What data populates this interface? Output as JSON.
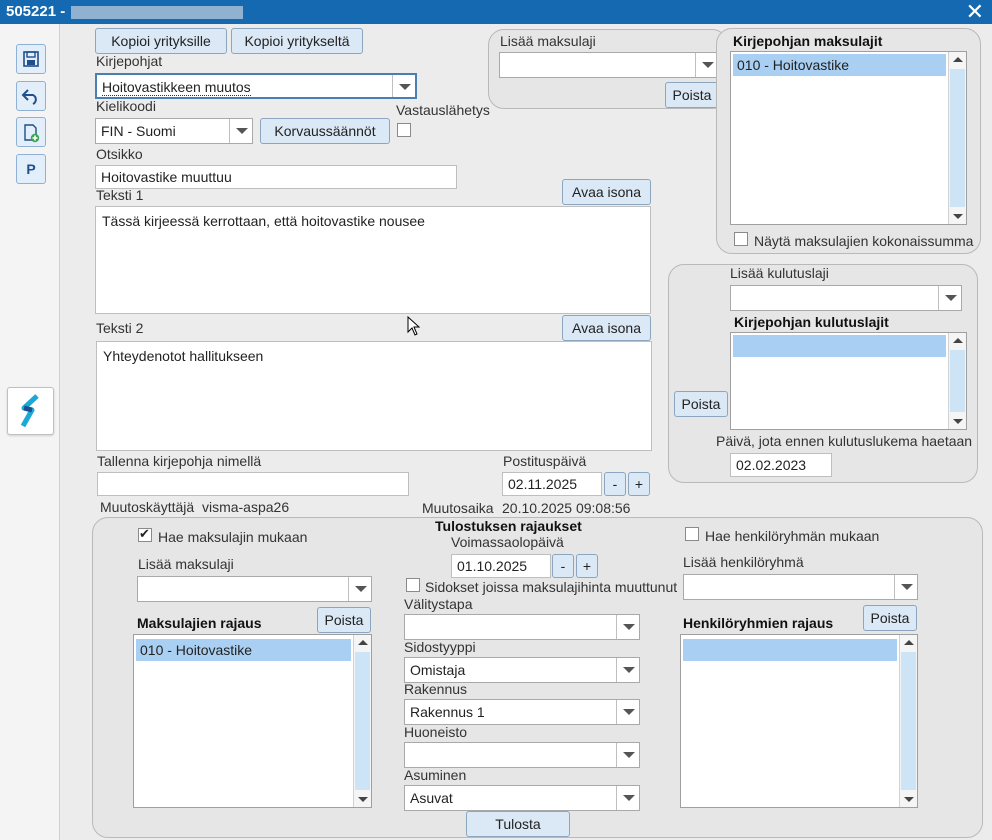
{
  "window": {
    "title": "505221 -",
    "close_label": "✕"
  },
  "toolbar": {
    "p_label": "P"
  },
  "header": {
    "copy_to_companies": "Kopioi yrityksille",
    "copy_from_company": "Kopioi yritykseltä"
  },
  "template": {
    "kirjepohjat_label": "Kirjepohjat",
    "kirjepohjat_value": "Hoitovastikkeen muutos",
    "kielikoodi_label": "Kielikoodi",
    "kielikoodi_value": "FIN - Suomi",
    "korvaussaannot": "Korvaussäännöt",
    "vastauslahetys_label": "Vastauslähetys",
    "otsikko_label": "Otsikko",
    "otsikko_value": "Hoitovastike muuttuu",
    "teksti1_label": "Teksti 1",
    "teksti1_value": "Tässä kirjeessä kerrottaan, että hoitovastike nousee",
    "teksti2_label": "Teksti 2",
    "teksti2_value": "Yhteydenotot hallitukseen",
    "open_large": "Avaa isona",
    "save_as_label": "Tallenna kirjepohja nimellä",
    "save_as_value": "",
    "postituspaiva_label": "Postituspäivä",
    "postituspaiva_value": "02.11.2025",
    "muutoskayttaja_label": "Muutoskäyttäjä",
    "muutoskayttaja_value": "visma-aspa26",
    "muutosaika_label": "Muutosaika",
    "muutosaika_value": "20.10.2025 09:08:56"
  },
  "payment_types": {
    "add_label": "Lisää maksulaji",
    "add_value": "",
    "remove": "Poista",
    "list_title": "Kirjepohjan maksulajit",
    "items": [
      "010 - Hoitovastike"
    ],
    "show_totals_label": "Näytä maksulajien kokonaissumma"
  },
  "consumption": {
    "add_label": "Lisää kulutuslaji",
    "add_value": "",
    "list_title": "Kirjepohjan kulutuslajit",
    "remove": "Poista",
    "date_label": "Päivä, jota ennen kulutuslukema haetaan",
    "date_value": "02.02.2023"
  },
  "print_limits": {
    "title": "Tulostuksen rajaukset",
    "search_by_payment": "Hae maksulajin mukaan",
    "search_by_group": "Hae henkilöryhmän mukaan",
    "validity_label": "Voimassaolopäivä",
    "validity_value": "01.10.2025",
    "price_changing_label": "Sidokset joissa maksulajihinta muuttunut",
    "add_payment_label": "Lisää maksulaji",
    "add_payment_value": "",
    "payment_limit_title": "Maksulajien rajaus",
    "payment_limit_items": [
      "010 - Hoitovastike"
    ],
    "remove": "Poista",
    "add_group_label": "Lisää henkilöryhmä",
    "add_group_value": "",
    "group_limit_title": "Henkilöryhmien rajaus",
    "valitystapa_label": "Välitystapa",
    "valitystapa_value": "",
    "sidostyyppi_label": "Sidostyyppi",
    "sidostyyppi_value": "Omistaja",
    "rakennus_label": "Rakennus",
    "rakennus_value": "Rakennus 1",
    "huoneisto_label": "Huoneisto",
    "huoneisto_value": "",
    "asuminen_label": "Asuminen",
    "asuminen_value": "Asuvat",
    "print_button": "Tulosta"
  },
  "stepper": {
    "minus": "-",
    "plus": "+"
  }
}
